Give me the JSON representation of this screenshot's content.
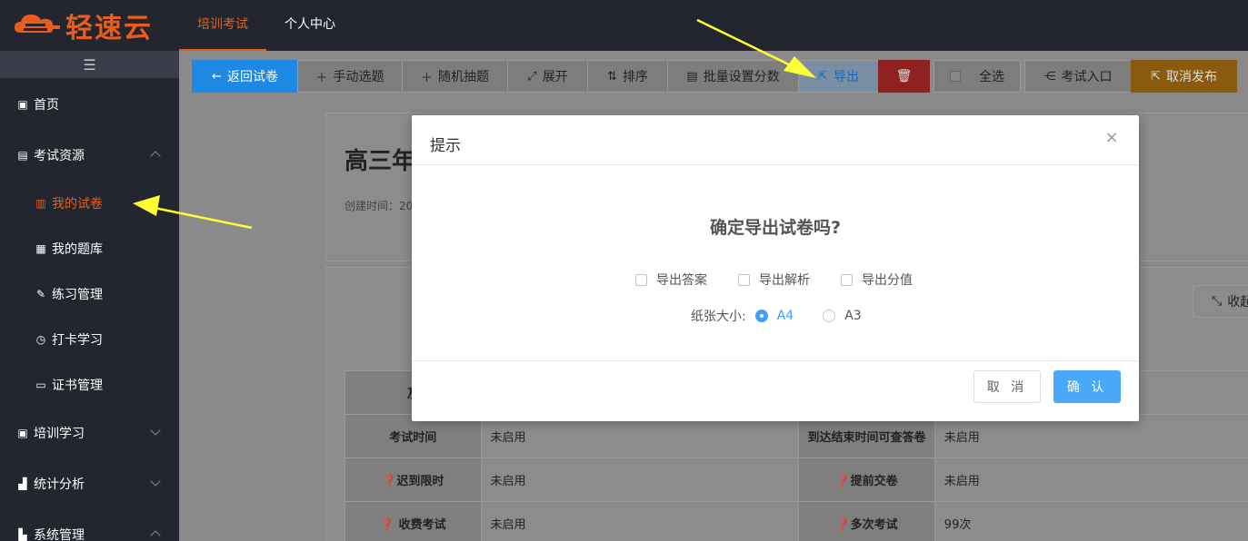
{
  "app": {
    "logo_text": "轻速云",
    "top_nav": [
      {
        "label": "培训考试",
        "active": true
      },
      {
        "label": "个人中心",
        "active": false
      }
    ]
  },
  "sidebar": {
    "toggle_icon": "menu-icon",
    "items": [
      {
        "label": "首页",
        "icon": "home-icon",
        "type": "parent"
      },
      {
        "label": "考试资源",
        "icon": "exam-resource-icon",
        "type": "parent",
        "expanded": true
      },
      {
        "label": "我的试卷",
        "icon": "paper-icon",
        "type": "child",
        "active": true
      },
      {
        "label": "我的题库",
        "icon": "question-bank-icon",
        "type": "child"
      },
      {
        "label": "练习管理",
        "icon": "pen-icon",
        "type": "child"
      },
      {
        "label": "打卡学习",
        "icon": "alarm-icon",
        "type": "child"
      },
      {
        "label": "证书管理",
        "icon": "certificate-icon",
        "type": "child"
      },
      {
        "label": "培训学习",
        "icon": "training-icon",
        "type": "parent"
      },
      {
        "label": "统计分析",
        "icon": "chart-icon",
        "type": "parent"
      },
      {
        "label": "系统管理",
        "icon": "settings-icon",
        "type": "parent"
      }
    ]
  },
  "toolbar": {
    "back": "返回试卷",
    "manual": "手动选题",
    "random": "随机抽题",
    "expand": "展开",
    "sort": "排序",
    "batch_score": "批量设置分数",
    "export": "导出",
    "select_all": "全选",
    "exam_entry": "考试入口",
    "unpublish": "取消发布"
  },
  "paper": {
    "title_partial": "高三年",
    "created_partial": "创建时间：20",
    "collapse_partial": "收起"
  },
  "info_table": {
    "rows": [
      {
        "l1": "及",
        "v1": "",
        "l2": "",
        "v2": ""
      },
      {
        "l1": "考试时间",
        "v1": "未启用",
        "l2": "到达结束时间可查答卷",
        "v2": "未启用"
      },
      {
        "l1": "❓迟到限时",
        "v1": "未启用",
        "l2": "❓提前交卷",
        "v2": "未启用"
      },
      {
        "l1": "❓ 收费考试",
        "v1": "未启用",
        "l2": "❓多次考试",
        "v2": "99次"
      }
    ]
  },
  "modal": {
    "title": "提示",
    "question": "确定导出试卷吗?",
    "options": [
      "导出答案",
      "导出解析",
      "导出分值"
    ],
    "paper_size_label": "纸张大小:",
    "paper_sizes": [
      {
        "label": "A4",
        "selected": true
      },
      {
        "label": "A3",
        "selected": false
      }
    ],
    "cancel": "取 消",
    "confirm": "确 认"
  },
  "colors": {
    "accent": "#e85d1c",
    "primary_blue": "#1e88e5",
    "confirm_blue": "#4aa8f8",
    "danger": "#e53935",
    "warning": "#e89817",
    "arrow": "#ffff33"
  }
}
